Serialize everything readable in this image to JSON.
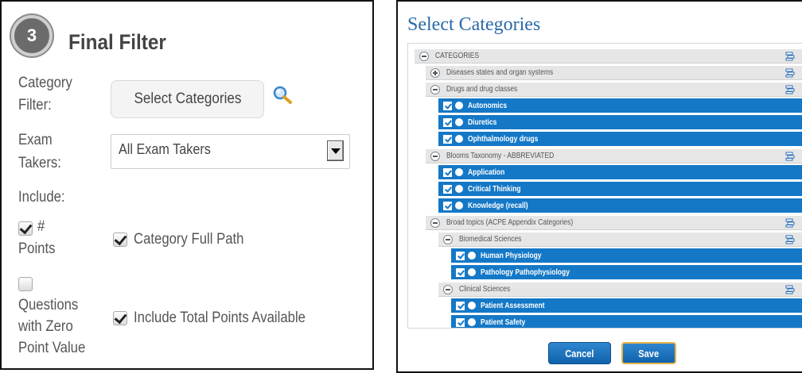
{
  "filter_panel": {
    "step_number": "3",
    "title": "Final Filter",
    "category_label_line1": "Category",
    "category_label_line2": "Filter:",
    "select_categories_button": "Select Categories",
    "exam_label_line1": "Exam",
    "exam_label_line2": "Takers:",
    "exam_takers_value": "All Exam Takers",
    "include_label": "Include:",
    "points_label_line1": "#",
    "points_label_line2": "Points",
    "points_checked": true,
    "category_full_path_label": "Category Full Path",
    "category_full_path_checked": true,
    "zero_line1": "Questions",
    "zero_line2": "with Zero",
    "zero_line3": "Point Value",
    "zero_checked": false,
    "total_points_label": "Include Total Points Available",
    "total_points_checked": true
  },
  "dialog": {
    "title": "Select Categories",
    "tree": [
      {
        "label": "CATEGORIES",
        "style": "gray",
        "level": 0,
        "toggle": "minus",
        "icon": true
      },
      {
        "label": "Diseases states and organ systems",
        "style": "gray",
        "level": 1,
        "toggle": "plus",
        "icon": true
      },
      {
        "label": "Drugs and drug classes",
        "style": "gray",
        "level": 1,
        "toggle": "minus",
        "icon": true
      },
      {
        "label": "Autonomics",
        "style": "blue",
        "level": 2
      },
      {
        "label": "Diuretics",
        "style": "blue",
        "level": 2
      },
      {
        "label": "Ophthalmology drugs",
        "style": "blue",
        "level": 2
      },
      {
        "label": "Blooms Taxonomy - ABBREVIATED",
        "style": "gray",
        "level": 1,
        "toggle": "minus",
        "icon": true
      },
      {
        "label": "Application",
        "style": "blue",
        "level": 2
      },
      {
        "label": "Critical Thinking",
        "style": "blue",
        "level": 2
      },
      {
        "label": "Knowledge (recall)",
        "style": "blue",
        "level": 2
      },
      {
        "label": "Broad topics (ACPE Appendix Categories)",
        "style": "gray",
        "level": 1,
        "toggle": "minus",
        "icon": true
      },
      {
        "label": "Biomedical Sciences",
        "style": "gray",
        "level": 2,
        "toggle": "minus",
        "icon": true
      },
      {
        "label": "Human Physiology",
        "style": "blue",
        "level": 3
      },
      {
        "label": "Pathology Pathophysiology",
        "style": "blue",
        "level": 3
      },
      {
        "label": "Clinical Sciences",
        "style": "gray",
        "level": 2,
        "toggle": "minus",
        "icon": true
      },
      {
        "label": "Patient Assessment",
        "style": "blue",
        "level": 3
      },
      {
        "label": "Patient Safety",
        "style": "blue",
        "level": 3
      }
    ],
    "cancel_label": "Cancel",
    "save_label": "Save"
  },
  "colors": {
    "selected_row": "#1478c7",
    "title_blue": "#2a6aa8",
    "group_row": "#e6e6e6",
    "save_border": "#e6b44a"
  }
}
